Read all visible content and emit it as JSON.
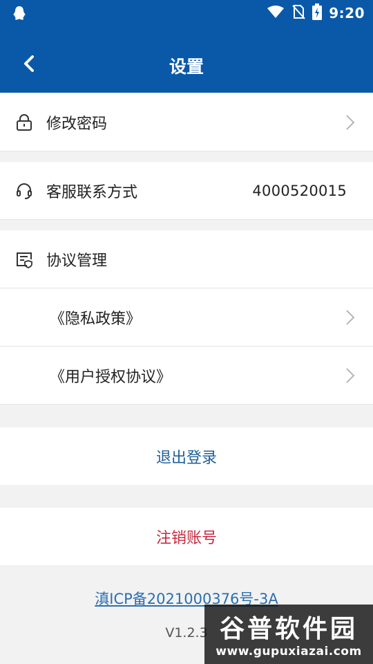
{
  "status_bar": {
    "time": "9:20",
    "icons": [
      "qq-icon",
      "wifi-icon",
      "no-sim-icon",
      "battery-icon"
    ]
  },
  "header": {
    "title": "设置",
    "back_icon": "chevron-left-icon",
    "bg_color": "#0a59a8"
  },
  "settings": {
    "change_password": {
      "label": "修改密码",
      "icon": "lock-icon"
    },
    "customer_service": {
      "label": "客服联系方式",
      "value": "4000520015",
      "icon": "headset-icon"
    },
    "agreements": {
      "label": "协议管理",
      "icon": "document-shield-icon",
      "items": [
        {
          "label": "《隐私政策》"
        },
        {
          "label": "《用户授权协议》"
        }
      ]
    }
  },
  "actions": {
    "logout": {
      "label": "退出登录",
      "color": "#1f5f9a"
    },
    "cancel_account": {
      "label": "注销账号",
      "color": "#c8283c"
    }
  },
  "footer": {
    "icp": "滇ICP备2021000376号-3A",
    "version": "V1.2.3"
  },
  "watermark": {
    "title": "谷普软件园",
    "url": "www.gupuxiazai.com"
  }
}
